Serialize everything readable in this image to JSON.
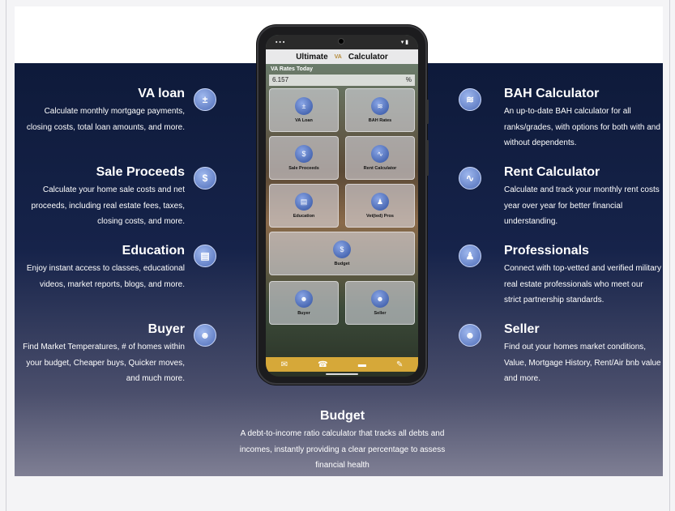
{
  "features_left": [
    {
      "title": "VA loan",
      "desc": "Calculate monthly mortgage payments, closing costs, total loan amounts, and more.",
      "icon": "calculator-icon",
      "glyph": "±"
    },
    {
      "title": "Sale Proceeds",
      "desc": "Calculate your home sale costs and net proceeds, including real estate fees, taxes, closing costs, and more.",
      "icon": "sale-proceeds-icon",
      "glyph": "$"
    },
    {
      "title": "Education",
      "desc": "Enjoy instant access to classes, educational videos, market reports, blogs, and more.",
      "icon": "education-icon",
      "glyph": "▤"
    },
    {
      "title": "Buyer",
      "desc": "Find Market Temperatures, # of homes within your budget, Cheaper buys, Quicker moves, and much more.",
      "icon": "buyer-robot-icon",
      "glyph": "☻"
    }
  ],
  "features_right": [
    {
      "title": "BAH Calculator",
      "desc": "An up-to-date BAH calculator for all ranks/grades, with options for both with and without dependents.",
      "icon": "rank-chevrons-icon",
      "glyph": "≋"
    },
    {
      "title": "Rent Calculator",
      "desc": "Calculate and track your monthly rent costs year over year for better financial understanding.",
      "icon": "chart-icon",
      "glyph": "∿"
    },
    {
      "title": "Professionals",
      "desc": "Connect with top-vetted and verified military real estate professionals who meet our strict partnership standards.",
      "icon": "professionals-icon",
      "glyph": "♟"
    },
    {
      "title": "Seller",
      "desc": "Find out your homes market conditions, Value, Mortgage History, Rent/Air bnb value and more.",
      "icon": "seller-robot-icon",
      "glyph": "☻"
    }
  ],
  "budget": {
    "title": "Budget",
    "desc": "A debt-to-income ratio calculator that tracks all debts and incomes, instantly providing a clear percentage to assess financial health"
  },
  "phone": {
    "title_left": "Ultimate",
    "title_mid": "VA",
    "title_right": "Calculator",
    "rates_label": "VA Rates Today",
    "rate_value": "6.157",
    "rate_unit": "%",
    "tiles": [
      {
        "label": "VA Loan",
        "glyph": "±"
      },
      {
        "label": "BAH Rates",
        "glyph": "≋"
      },
      {
        "label": "Sale Proceeds",
        "glyph": "$"
      },
      {
        "label": "Rent Calculator",
        "glyph": "∿"
      },
      {
        "label": "Education",
        "glyph": "▤"
      },
      {
        "label": "Vet(ted) Pros",
        "glyph": "♟"
      },
      {
        "label": "Budget",
        "glyph": "$"
      },
      {
        "label": "Buyer",
        "glyph": "☻"
      },
      {
        "label": "Seller",
        "glyph": "☻"
      }
    ],
    "bottom_icons": [
      "✉",
      "☎",
      "▬",
      "✎"
    ]
  },
  "colors": {
    "panel_top": "#0e1a3a",
    "panel_bottom": "#7f7f94",
    "accent_gold": "#d6a839",
    "icon_blue": "#4f6db8"
  }
}
